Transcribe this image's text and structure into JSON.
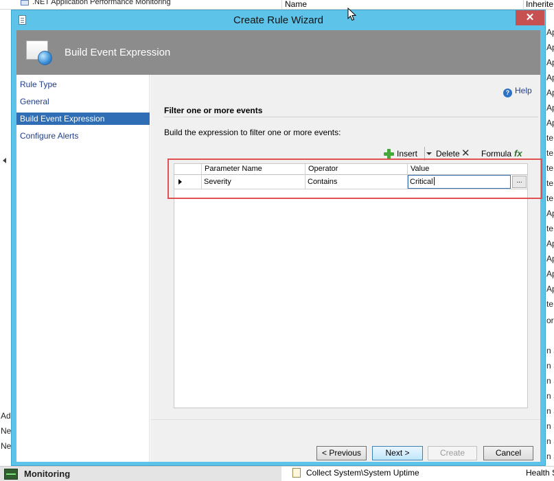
{
  "background": {
    "top_left_text": ".NET Application Performance Monitoring",
    "column_name": "Name",
    "column_inherited": "Inherite",
    "left_fragments": [
      "Ad",
      "Ne",
      "Ne"
    ],
    "right_fragments": [
      "Ap",
      "Ap",
      "Ap",
      "Ap",
      "Ap",
      "Ap",
      "Ap",
      "te",
      "te",
      "te",
      "te",
      "te",
      "Ap",
      "te",
      "Ap",
      "Ap",
      "Ap",
      "Ap",
      "te",
      "or",
      "n S",
      "n S",
      "n S",
      "n S",
      "n S",
      "n S",
      "n S",
      "n S"
    ],
    "status_left_label": "Monitoring",
    "status_item_label": "Collect System\\System Uptime",
    "status_right_label": "Health S"
  },
  "wizard": {
    "title": "Create Rule Wizard",
    "close_label": "✕",
    "header_title": "Build Event Expression",
    "nav": [
      {
        "label": "Rule Type",
        "selected": false
      },
      {
        "label": "General",
        "selected": false
      },
      {
        "label": "Build Event Expression",
        "selected": true
      },
      {
        "label": "Configure Alerts",
        "selected": false
      }
    ],
    "help_label": "Help",
    "section_title": "Filter one or more events",
    "description": "Build the expression to filter one or more events:",
    "toolbar": {
      "insert_label": "Insert",
      "delete_label": "Delete",
      "formula_label": "Formula"
    },
    "grid": {
      "columns": [
        "Parameter Name",
        "Operator",
        "Value"
      ],
      "rows": [
        {
          "parameter": "Severity",
          "operator": "Contains",
          "value": "Critical"
        }
      ],
      "ellipsis_label": "..."
    },
    "buttons": {
      "previous": "< Previous",
      "next": "Next >",
      "create": "Create",
      "cancel": "Cancel"
    }
  }
}
